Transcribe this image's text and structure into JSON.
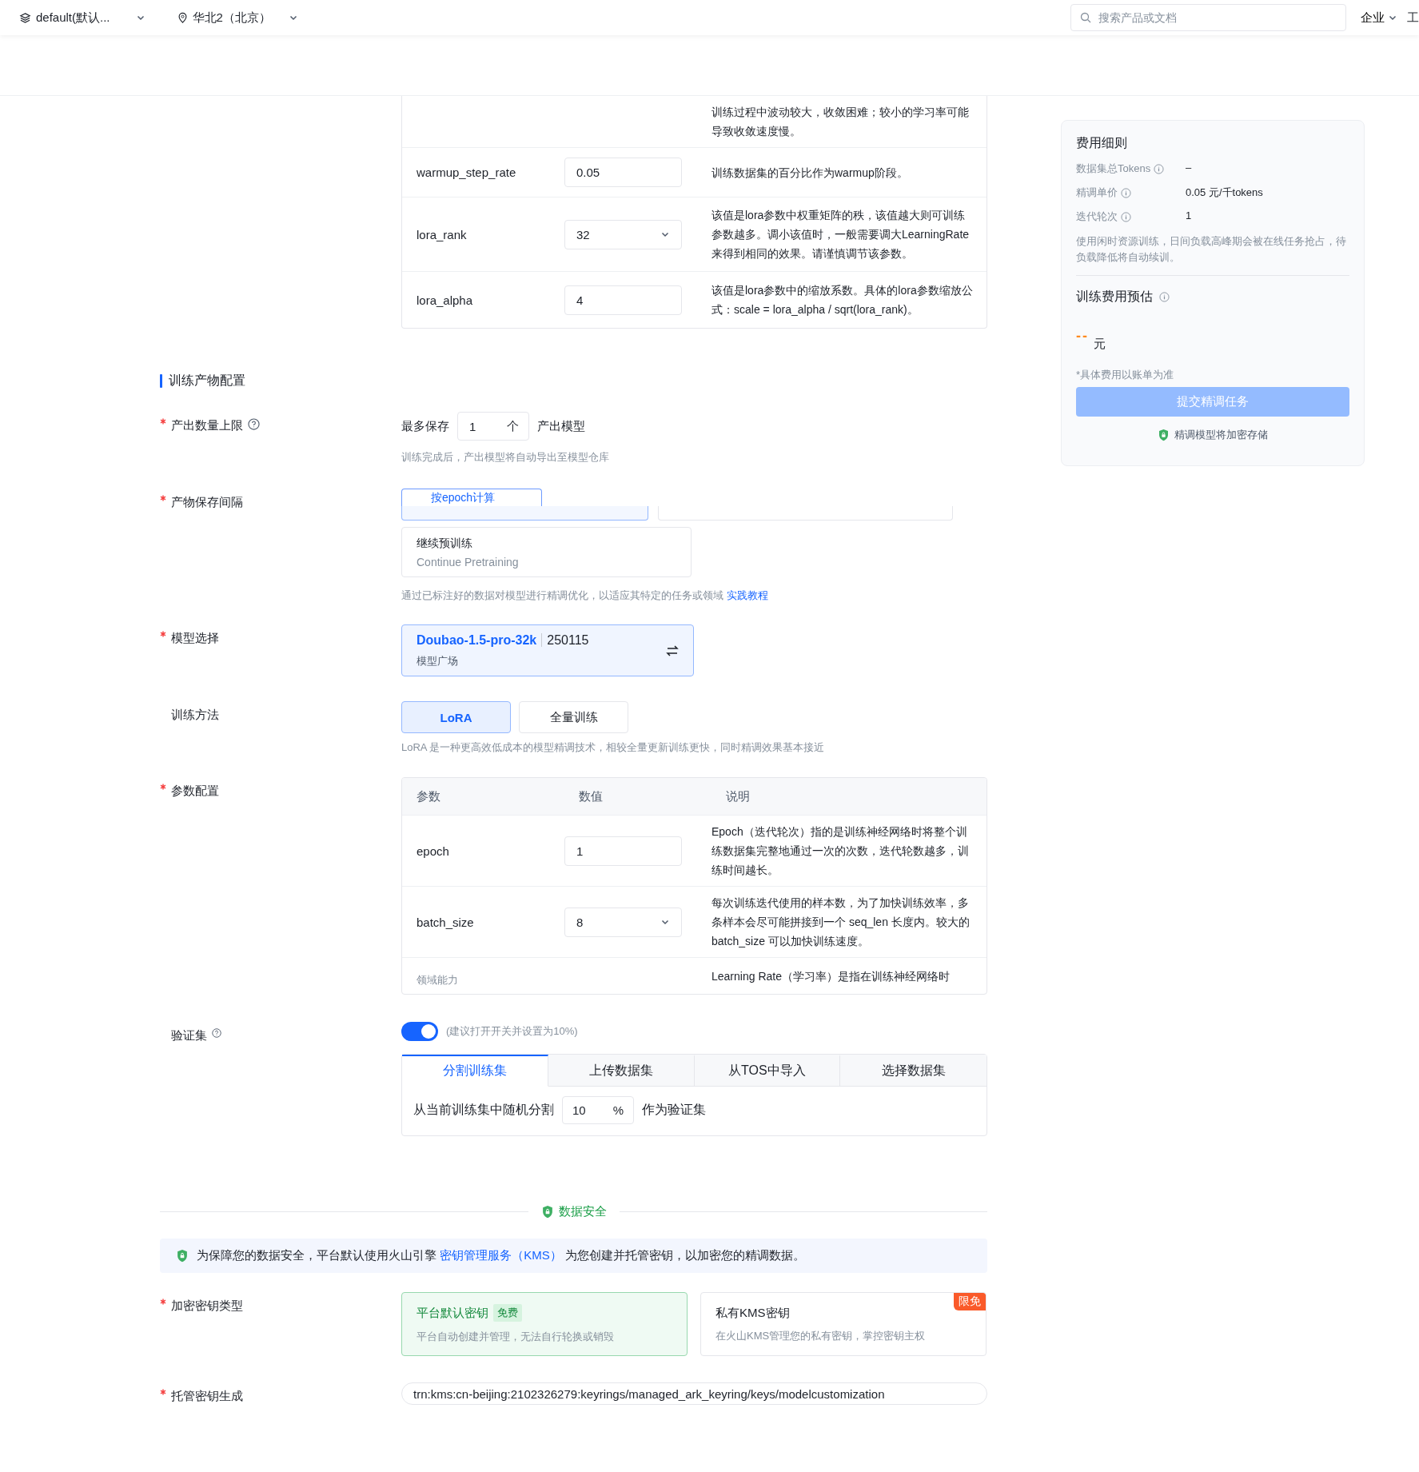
{
  "topbar": {
    "project": "default(默认...",
    "region": "华北2（北京）",
    "search": {
      "placeholder": "搜索产品或文档"
    },
    "menu": "企业",
    "edge": "工"
  },
  "top_params": {
    "rows": [
      {
        "kind": "partial",
        "name": "",
        "value": "",
        "desc": "训练过程中波动较大，收敛困难；较小的学习率可能导致收敛速度慢。"
      },
      {
        "kind": "input",
        "name": "warmup_step_rate",
        "value": "0.05",
        "desc": "训练数据集的百分比作为warmup阶段。"
      },
      {
        "kind": "select",
        "name": "lora_rank",
        "value": "32",
        "desc": "该值是lora参数中权重矩阵的秩，该值越大则可训练参数越多。调小该值时，一般需要调大LearningRate来得到相同的效果。请谨慎调节该参数。"
      },
      {
        "kind": "input",
        "name": "lora_alpha",
        "value": "4",
        "desc": "该值是lora参数中的缩放系数。具体的lora参数缩放公式：scale = lora_alpha / sqrt(lora_rank)。"
      }
    ]
  },
  "artifact": {
    "title": "训练产物配置",
    "count": {
      "label": "产出数量上限",
      "required": true,
      "prefix": "最多保存",
      "value": "1",
      "unit": "个",
      "suffix": "产出模型",
      "hint": "训练完成后，产出模型将自动导出至模型仓库"
    },
    "interval": {
      "label": "产物保存间隔",
      "required": true,
      "option": "按epoch计算",
      "selected": true
    }
  },
  "training_type": {
    "cards": [
      {
        "title": "继续预训练",
        "subtitle": "Continue Pretraining",
        "selected": false
      }
    ],
    "hint": "通过已标注好的数据对模型进行精调优化，以适应其特定的任务或领域",
    "link": "实践教程"
  },
  "model": {
    "label": "模型选择",
    "required": true,
    "name": "Doubao-1.5-pro-32k",
    "version": "250115",
    "source": "模型广场"
  },
  "method": {
    "label": "训练方法",
    "required": false,
    "options": [
      {
        "label": "LoRA",
        "selected": true
      },
      {
        "label": "全量训练",
        "selected": false
      }
    ],
    "hint": "LoRA 是一种更高效低成本的模型精调技术，相较全量更新训练更快，同时精调效果基本接近"
  },
  "params": {
    "label": "参数配置",
    "required": true,
    "columns": [
      "参数",
      "数值",
      "说明"
    ],
    "rows": [
      {
        "kind": "input",
        "name": "epoch",
        "value": "1",
        "desc": "Epoch（迭代轮次）指的是训练神经网络时将整个训练数据集完整地通过一次的次数，迭代轮数越多，训练时间越长。"
      },
      {
        "kind": "select",
        "name": "batch_size",
        "value": "8",
        "desc": "每次训练迭代使用的样本数，为了加快训练效率，多条样本会尽可能拼接到一个 seq_len 长度内。较大的 batch_size 可以加快训练速度。"
      },
      {
        "kind": "partial",
        "name": "领域能力",
        "value": "",
        "desc": "Learning Rate（学习率）是指在训练神经网络时"
      }
    ]
  },
  "validation": {
    "label": "验证集",
    "required": false,
    "on": true,
    "switch_hint": "(建议打开开关并设置为10%)",
    "tabs": [
      {
        "label": "分割训练集",
        "selected": true
      },
      {
        "label": "上传数据集",
        "selected": false
      },
      {
        "label": "从TOS中导入",
        "selected": false
      },
      {
        "label": "选择数据集",
        "selected": false
      }
    ],
    "split": {
      "prefix": "从当前训练集中随机分割",
      "value": "10",
      "unit": "%",
      "suffix": "作为验证集"
    }
  },
  "security": {
    "divider": "数据安全",
    "banner": {
      "before": "为保障您的数据安全，平台默认使用火山引擎",
      "link": "密钥管理服务（KMS）",
      "after": "为您创建并托管密钥，以加密您的精调数据。"
    },
    "key_type": {
      "label": "加密密钥类型",
      "required": true,
      "options": [
        {
          "title": "平台默认密钥",
          "tag": "免费",
          "desc": "平台自动创建并管理，无法自行轮换或销毁",
          "selected": true
        },
        {
          "title": "私有KMS密钥",
          "ribbon": "限免",
          "desc": "在火山KMS管理您的私有密钥，掌控密钥主权",
          "selected": false
        }
      ]
    },
    "key_gen": {
      "label": "托管密钥生成",
      "required": true,
      "value": "trn:kms:cn-beijing:2102326279:keyrings/managed_ark_keyring/keys/modelcustomization"
    }
  },
  "cost": {
    "title": "费用细则",
    "items": [
      {
        "label": "数据集总Tokens",
        "value": "–"
      },
      {
        "label": "精调单价",
        "value": "0.05 元/千tokens"
      },
      {
        "label": "迭代轮次",
        "value": "1"
      }
    ],
    "note": "使用闲时资源训练，日间负载高峰期会被在线任务抢占，待负载降低将自动续训。",
    "estimate_title": "训练费用预估",
    "estimate_value": "--",
    "estimate_unit": "元",
    "disclaimer": "*具体费用以账单为准",
    "submit": {
      "label": "提交精调任务",
      "disabled": true
    },
    "footer": "精调模型将加密存储"
  }
}
